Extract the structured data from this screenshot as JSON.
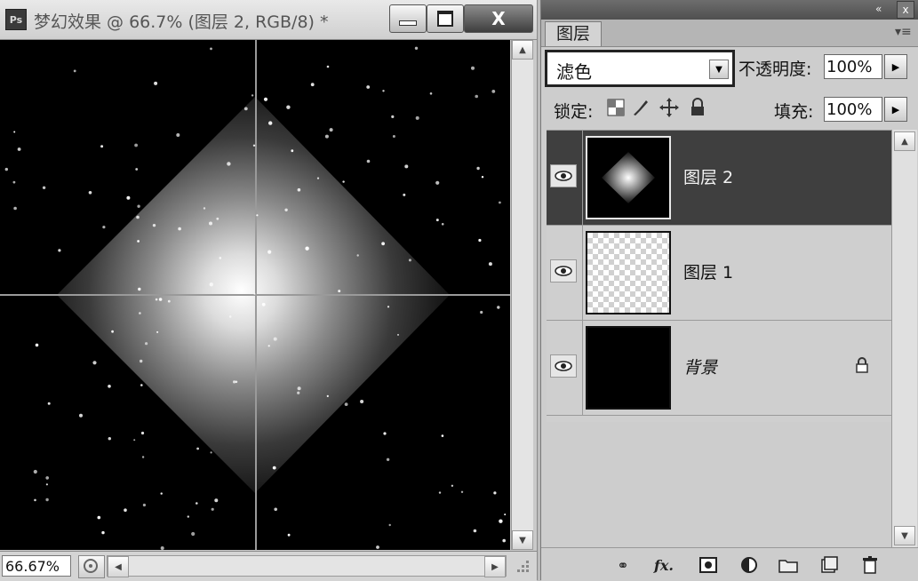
{
  "document": {
    "app_badge": "Ps",
    "title": "梦幻效果 @ 66.7% (图层 2, RGB/8) *",
    "zoom": "66.67%"
  },
  "window_buttons": {
    "minimize": "minimize",
    "maximize": "maximize",
    "close": "X"
  },
  "panel": {
    "tab_label": "图层",
    "blend_mode": "滤色",
    "opacity_label": "不透明度:",
    "opacity_value": "100%",
    "lock_label": "锁定:",
    "fill_label": "填充:",
    "fill_value": "100%",
    "collapse_icon": "«",
    "close_icon": "x"
  },
  "layers": [
    {
      "name": "图层 2",
      "visible": true,
      "selected": true,
      "thumbnail": "diamond-glow"
    },
    {
      "name": "图层 1",
      "visible": true,
      "selected": false,
      "thumbnail": "transparent-checker"
    },
    {
      "name": "背景",
      "visible": true,
      "selected": false,
      "thumbnail": "black-fill",
      "locked": true
    }
  ],
  "bottom_icons": [
    "link-layers-icon",
    "fx-icon",
    "add-mask-icon",
    "adjustment-layer-icon",
    "new-group-icon",
    "new-layer-icon",
    "trash-icon"
  ],
  "colors": {
    "canvas": "#000000",
    "selected_row": "#3f3f3f",
    "panel": "#cdcdcd"
  }
}
